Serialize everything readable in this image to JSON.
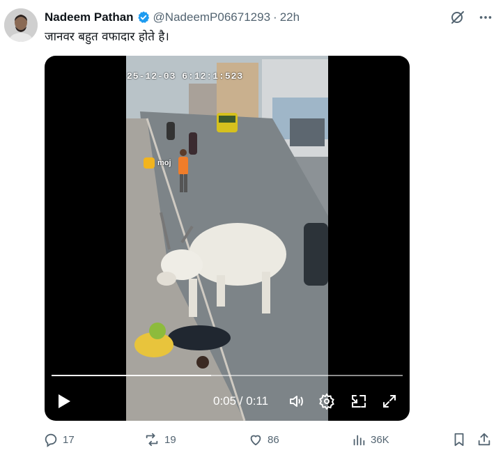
{
  "author": {
    "display_name": "Nadeem Pathan",
    "handle": "@NadeemP06671293",
    "separator": "·",
    "time_ago": "22h"
  },
  "tweet": {
    "text": "जानवर बहुत वफादार होते है।"
  },
  "video": {
    "overlay_timestamp": "25-12-03  6:12:1:523",
    "watermark": "moj",
    "elapsed": "0:05",
    "duration": "0:11",
    "time_readout": "0:05 / 0:11",
    "progress_fraction": 0.4545
  },
  "actions": {
    "replies": "17",
    "reposts": "19",
    "likes": "86",
    "views": "36K"
  },
  "colors": {
    "text_primary": "#0f1419",
    "text_secondary": "#536471",
    "verified": "#1d9bf0",
    "media_bg": "#000000"
  },
  "icons": {
    "verified": "verified-badge-icon",
    "grok": "grok-icon",
    "more": "more-icon",
    "play": "play-icon",
    "volume": "volume-icon",
    "settings": "settings-icon",
    "pip": "picture-in-picture-icon",
    "fullscreen": "fullscreen-icon",
    "reply": "reply-icon",
    "repost": "repost-icon",
    "like": "like-icon",
    "views": "views-icon",
    "bookmark": "bookmark-icon",
    "share": "share-icon"
  }
}
